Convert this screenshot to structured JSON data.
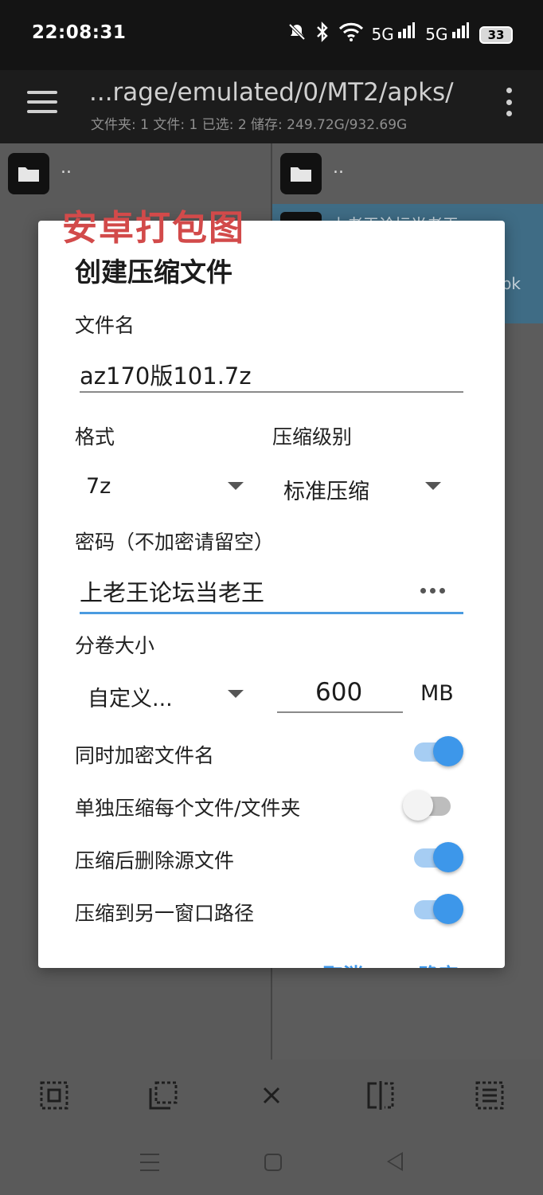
{
  "status_bar": {
    "time": "22:08:31",
    "battery": "33",
    "network_labels": [
      "5G",
      "5G"
    ]
  },
  "app_bar": {
    "path": "...rage/emulated/0/MT2/apks/",
    "info": "文件夹: 1  文件: 1  已选: 2  储存: 249.72G/932.69G"
  },
  "panes": {
    "left_parent": "..",
    "right_parent": "..",
    "right_selected_title": "上老王论坛当老王",
    "right_selected_ext": "pk"
  },
  "watermark": "安卓打包图",
  "dialog": {
    "title": "创建压缩文件",
    "filename_label": "文件名",
    "filename_value": "az170版101.7z",
    "format_label": "格式",
    "format_value": "7z",
    "level_label": "压缩级别",
    "level_value": "标准压缩",
    "password_label": "密码（不加密请留空）",
    "password_value": "上老王论坛当老王",
    "volume_label": "分卷大小",
    "volume_mode": "自定义...",
    "volume_size": "600",
    "volume_unit": "MB",
    "options": [
      {
        "label": "同时加密文件名",
        "on": true
      },
      {
        "label": "单独压缩每个文件/文件夹",
        "on": false
      },
      {
        "label": "压缩后删除源文件",
        "on": true
      },
      {
        "label": "压缩到另一窗口路径",
        "on": true
      }
    ],
    "cancel_label": "取消",
    "ok_label": "确定"
  },
  "colors": {
    "accent": "#3d97ea",
    "watermark": "#d24a4a",
    "selected_row": "#3f6c85"
  }
}
